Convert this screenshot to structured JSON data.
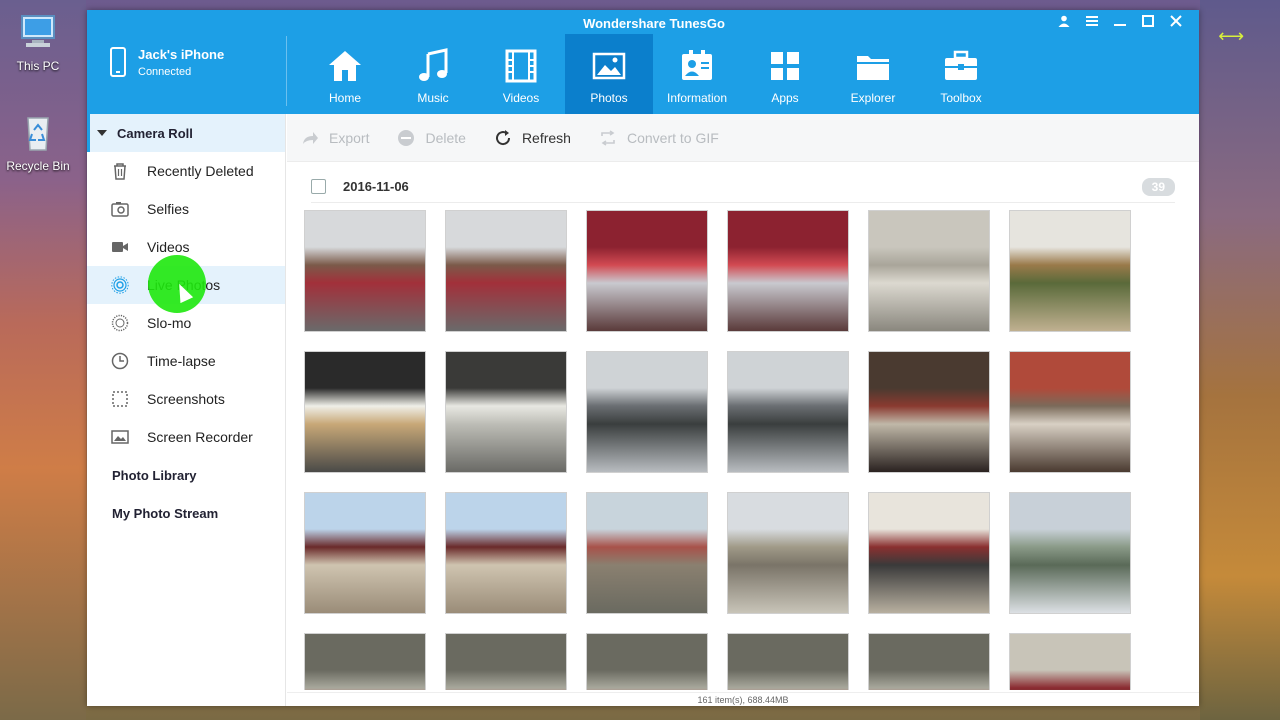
{
  "desktop": {
    "icons": [
      {
        "label": "This PC",
        "icon": "computer-icon"
      },
      {
        "label": "Recycle Bin",
        "icon": "recycle-bin-icon"
      }
    ]
  },
  "window": {
    "title": "Wondershare TunesGo",
    "controls": [
      "user-icon",
      "menu-icon",
      "minimize-icon",
      "maximize-icon",
      "close-icon"
    ]
  },
  "device": {
    "name": "Jack's iPhone",
    "status": "Connected"
  },
  "nav": {
    "tabs": [
      {
        "label": "Home",
        "icon": "home-icon"
      },
      {
        "label": "Music",
        "icon": "music-icon"
      },
      {
        "label": "Videos",
        "icon": "film-icon"
      },
      {
        "label": "Photos",
        "icon": "photo-icon",
        "active": true
      },
      {
        "label": "Information",
        "icon": "contact-card-icon"
      },
      {
        "label": "Apps",
        "icon": "apps-icon"
      },
      {
        "label": "Explorer",
        "icon": "folder-icon"
      },
      {
        "label": "Toolbox",
        "icon": "toolbox-icon"
      }
    ]
  },
  "sidebar": {
    "section": "Camera Roll",
    "items": [
      {
        "label": "Recently Deleted",
        "icon": "trash-icon"
      },
      {
        "label": "Selfies",
        "icon": "selfie-camera-icon"
      },
      {
        "label": "Videos",
        "icon": "video-camera-icon"
      },
      {
        "label": "Live Photos",
        "icon": "live-photo-icon",
        "selected": true
      },
      {
        "label": "Slo-mo",
        "icon": "slomo-icon"
      },
      {
        "label": "Time-lapse",
        "icon": "timelapse-icon"
      },
      {
        "label": "Screenshots",
        "icon": "screenshot-icon"
      },
      {
        "label": "Screen Recorder",
        "icon": "screen-recorder-icon"
      }
    ],
    "groups": [
      "Photo Library",
      "My Photo Stream"
    ]
  },
  "toolbar": {
    "export": "Export",
    "delete": "Delete",
    "refresh": "Refresh",
    "convert": "Convert to GIF"
  },
  "gallery": {
    "date": "2016-11-06",
    "count": "39",
    "footer": "161 item(s), 688.44MB"
  },
  "colors": {
    "brand": "#1d9fe6",
    "active_tab": "#0b7fcc",
    "selection": "#e4f2fc",
    "cursor_highlight": "#1ee80d"
  }
}
